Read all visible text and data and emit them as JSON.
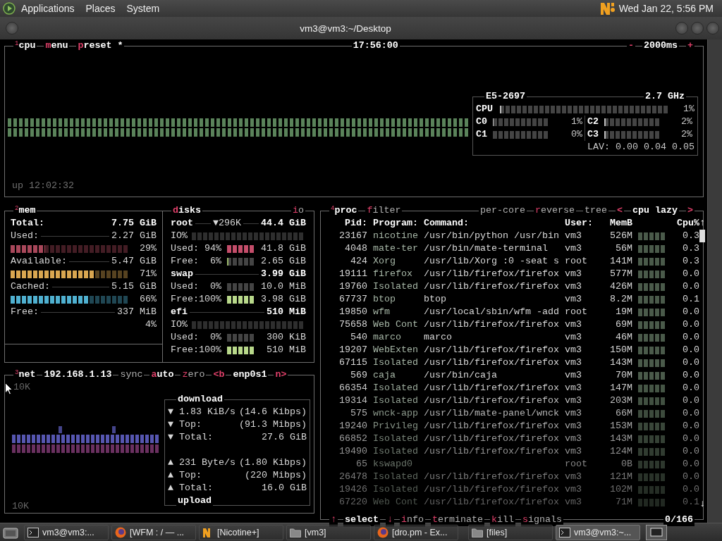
{
  "top_panel": {
    "menus": [
      "Applications",
      "Places",
      "System"
    ],
    "clock": "Wed Jan 22, 5:56 PM"
  },
  "window": {
    "title": "vm3@vm3:~/Desktop"
  },
  "cpu": {
    "header_left": [
      {
        "kind": "title",
        "label": "$^{1}$cpu"
      },
      {
        "kind": "active",
        "label": "menu",
        "accent_first": true
      },
      {
        "kind": "active",
        "label": "preset *",
        "accent_first": true
      }
    ],
    "clock": "17:56:00",
    "header_right": [
      {
        "kind": "key",
        "label": "-"
      },
      {
        "kind": "title",
        "label": "2000ms"
      },
      {
        "kind": "key",
        "label": "+"
      }
    ],
    "model": "E5-2697",
    "frequency": "2.7 GHz",
    "total": {
      "label": "CPU",
      "level": 0.01,
      "reading": "1%"
    },
    "cores": [
      {
        "label": "C0",
        "level": 0.01,
        "reading": "1%"
      },
      {
        "label": "C2",
        "level": 0.02,
        "reading": "2%"
      },
      {
        "label": "C1",
        "reading": "0%"
      },
      {
        "label": "C3",
        "level": 0.02,
        "reading": "2%"
      }
    ],
    "load": "LAV: 0.00 0.04 0.05",
    "uptime": "up 12:02:32"
  },
  "mem": {
    "header": [
      {
        "kind": "title",
        "label": "$^{2}$mem"
      }
    ],
    "rows": [
      {
        "kind": "total",
        "label": "Total:",
        "value": "7.75 GiB"
      },
      {
        "kind": "meter",
        "label": "Used:",
        "value": "2.27 GiB",
        "level": 0.29,
        "reading": "29%",
        "color": "#a8475a"
      },
      {
        "kind": "meter",
        "label": "Available:",
        "value": "5.47 GiB",
        "level": 0.71,
        "reading": "71%",
        "color": "#d9a650"
      },
      {
        "kind": "meter",
        "label": "Cached:",
        "value": "5.15 GiB",
        "level": 0.66,
        "reading": "66%",
        "color": "#4fb0d0"
      },
      {
        "kind": "plain",
        "label": "Free:",
        "value": "337 MiB",
        "reading": "4%"
      }
    ]
  },
  "disks": {
    "header_left": [
      {
        "kind": "active",
        "label": "disks",
        "accent_first": true
      }
    ],
    "header_right": [
      {
        "kind": "option",
        "label": "io",
        "accent_first": true
      }
    ],
    "volumes": [
      {
        "name": "root",
        "io_rate": "▼296K",
        "size": "44.4 GiB",
        "rows": [
          {
            "kind": "io",
            "label": "IO%"
          },
          {
            "kind": "usage",
            "label": "Used:",
            "percent": "94%",
            "level": 0.94,
            "value": "41.8 GiB",
            "color": "#c44d6a"
          },
          {
            "kind": "usage",
            "label": "Free:",
            "percent": "6%",
            "level": 0.06,
            "value": "2.65 GiB",
            "color": "#9ab86a"
          }
        ]
      },
      {
        "name": "swap",
        "size": "3.99 GiB",
        "rows": [
          {
            "kind": "usage",
            "label": "Used:",
            "percent": "0%",
            "value": "10.0 MiB"
          },
          {
            "kind": "usage",
            "label": "Free:",
            "percent": "100%",
            "level": 1,
            "value": "3.98 GiB",
            "color": "#b8d88a"
          }
        ]
      },
      {
        "name": "efi",
        "size": "510 MiB",
        "rows": [
          {
            "kind": "io",
            "label": "IO%"
          },
          {
            "kind": "usage",
            "label": "Used:",
            "percent": "0%",
            "value": "300 KiB"
          },
          {
            "kind": "usage",
            "label": "Free:",
            "percent": "100%",
            "level": 1,
            "value": "510 MiB",
            "color": "#b8d88a"
          }
        ]
      }
    ]
  },
  "net": {
    "header": [
      {
        "kind": "title",
        "label": "$^{3}$net"
      },
      {
        "kind": "title",
        "label": "192.168.1.13"
      },
      {
        "kind": "option",
        "label": "sync",
        "accent_first": false
      },
      {
        "kind": "active",
        "label": "auto",
        "accent_first": true
      },
      {
        "kind": "option",
        "label": "zero",
        "accent_first": true
      },
      {
        "kind": "key",
        "label": "<b"
      },
      {
        "kind": "title",
        "label": "enp0s1"
      },
      {
        "kind": "key",
        "label": "n>"
      }
    ],
    "scale_top": "10K",
    "scale_bottom": "10K",
    "download": {
      "title": "download",
      "rows": [
        {
          "arrow": "▼",
          "label": "1.83 KiB/s",
          "value": "(14.6 Kibps)"
        },
        {
          "arrow": "▼",
          "label": "Top:",
          "value": "(91.3 Mibps)"
        },
        {
          "arrow": "▼",
          "label": "Total:",
          "value": "27.6 GiB"
        }
      ]
    },
    "upload": {
      "title": "upload",
      "rows": [
        {
          "arrow": "▲",
          "label": "231 Byte/s",
          "value": "(1.80 Kibps)"
        },
        {
          "arrow": "▲",
          "label": "Top:",
          "value": "(220 Mibps)"
        },
        {
          "arrow": "▲",
          "label": "Total:",
          "value": "16.0 GiB"
        }
      ]
    }
  },
  "proc": {
    "header_left": [
      {
        "kind": "title",
        "label": "$^{4}$proc"
      },
      {
        "kind": "option",
        "label": "filter",
        "accent_first": true
      }
    ],
    "header_right": [
      {
        "kind": "option",
        "label": "per-core",
        "accent_first": false
      },
      {
        "kind": "option",
        "label": "reverse",
        "accent_first": true
      },
      {
        "kind": "option",
        "label": "tree",
        "accent_first": false
      },
      {
        "kind": "key",
        "label": "<"
      },
      {
        "kind": "title",
        "label": "cpu lazy"
      },
      {
        "kind": "key",
        "label": ">"
      }
    ],
    "columns": [
      "Pid:",
      "Program:",
      "Command:",
      "User:",
      "MemB",
      "Cpu%"
    ],
    "scroll_up": "↑",
    "scroll_down": "↓",
    "rows": [
      {
        "pid": "23167",
        "program": "nicotine",
        "command": "/usr/bin/python /usr/bin",
        "user": "vm3",
        "mem": "526M",
        "cpu": "0.3"
      },
      {
        "pid": "4048",
        "program": "mate-ter",
        "command": "/usr/bin/mate-terminal",
        "user": "vm3",
        "mem": "56M",
        "cpu": "0.3"
      },
      {
        "pid": "424",
        "program": "Xorg",
        "command": "/usr/lib/Xorg :0 -seat s",
        "user": "root",
        "mem": "141M",
        "cpu": "0.3"
      },
      {
        "pid": "19111",
        "program": "firefox",
        "command": "/usr/lib/firefox/firefox",
        "user": "vm3",
        "mem": "577M",
        "cpu": "0.0"
      },
      {
        "pid": "19760",
        "program": "Isolated",
        "command": "/usr/lib/firefox/firefox",
        "user": "vm3",
        "mem": "426M",
        "cpu": "0.0"
      },
      {
        "pid": "67737",
        "program": "btop",
        "command": "btop",
        "user": "vm3",
        "mem": "8.2M",
        "cpu": "0.1"
      },
      {
        "pid": "19850",
        "program": "wfm",
        "command": "/usr/local/sbin/wfm -add",
        "user": "root",
        "mem": "19M",
        "cpu": "0.0"
      },
      {
        "pid": "75658",
        "program": "Web Cont",
        "command": "/usr/lib/firefox/firefox",
        "user": "vm3",
        "mem": "69M",
        "cpu": "0.0"
      },
      {
        "pid": "540",
        "program": "marco",
        "command": "marco",
        "user": "vm3",
        "mem": "46M",
        "cpu": "0.0"
      },
      {
        "pid": "19207",
        "program": "WebExten",
        "command": "/usr/lib/firefox/firefox",
        "user": "vm3",
        "mem": "150M",
        "cpu": "0.0"
      },
      {
        "pid": "67115",
        "program": "Isolated",
        "command": "/usr/lib/firefox/firefox",
        "user": "vm3",
        "mem": "143M",
        "cpu": "0.0"
      },
      {
        "pid": "569",
        "program": "caja",
        "command": "/usr/bin/caja",
        "user": "vm3",
        "mem": "70M",
        "cpu": "0.0"
      },
      {
        "pid": "66354",
        "program": "Isolated",
        "command": "/usr/lib/firefox/firefox",
        "user": "vm3",
        "mem": "147M",
        "cpu": "0.0"
      },
      {
        "pid": "19314",
        "program": "Isolated",
        "command": "/usr/lib/firefox/firefox",
        "user": "vm3",
        "mem": "203M",
        "cpu": "0.0"
      },
      {
        "pid": "575",
        "program": "wnck-app",
        "command": "/usr/lib/mate-panel/wnck",
        "user": "vm3",
        "mem": "66M",
        "cpu": "0.0"
      },
      {
        "pid": "19240",
        "program": "Privileg",
        "command": "/usr/lib/firefox/firefox",
        "user": "vm3",
        "mem": "153M",
        "cpu": "0.0"
      },
      {
        "pid": "66852",
        "program": "Isolated",
        "command": "/usr/lib/firefox/firefox",
        "user": "vm3",
        "mem": "143M",
        "cpu": "0.0"
      },
      {
        "pid": "19490",
        "program": "Isolated",
        "command": "/usr/lib/firefox/firefox",
        "user": "vm3",
        "mem": "124M",
        "cpu": "0.0"
      },
      {
        "pid": "65",
        "program": "kswapd0",
        "user": "root",
        "mem": "0B",
        "cpu": "0.0"
      },
      {
        "pid": "26478",
        "program": "Isolated",
        "command": "/usr/lib/firefox/firefox",
        "user": "vm3",
        "mem": "121M",
        "cpu": "0.0"
      },
      {
        "pid": "19426",
        "program": "Isolated",
        "command": "/usr/lib/firefox/firefox",
        "user": "vm3",
        "mem": "102M",
        "cpu": "0.0"
      },
      {
        "pid": "67220",
        "program": "Web Cont",
        "command": "/usr/lib/firefox/firefox",
        "user": "vm3",
        "mem": "71M",
        "cpu": "0.1"
      }
    ],
    "footer_left": [
      {
        "kind": "key",
        "label": "↑"
      },
      {
        "kind": "title",
        "label": "select"
      },
      {
        "kind": "key",
        "label": "↓"
      },
      {
        "kind": "option",
        "label": "info",
        "accent_first": true
      },
      {
        "kind": "option",
        "label": "terminate",
        "accent_first": true
      },
      {
        "kind": "option",
        "label": "kill",
        "accent_first": true
      },
      {
        "kind": "option",
        "label": "signals",
        "accent_first": true
      }
    ],
    "count": "0/166"
  },
  "taskbar": [
    {
      "kind": "terminal",
      "label": "vm3@vm3:...",
      "selected": false
    },
    {
      "kind": "firefox",
      "label": "[WFM : / — ...",
      "selected": false
    },
    {
      "kind": "nicotine",
      "label": "[Nicotine+]",
      "selected": false
    },
    {
      "kind": "folder",
      "label": "[vm3]",
      "selected": false
    },
    {
      "kind": "firefox",
      "label": "[dro.pm - Ex...",
      "selected": false
    },
    {
      "kind": "folder",
      "label": "[files]",
      "selected": false
    },
    {
      "kind": "terminal",
      "label": "vm3@vm3:~...",
      "selected": true
    }
  ]
}
